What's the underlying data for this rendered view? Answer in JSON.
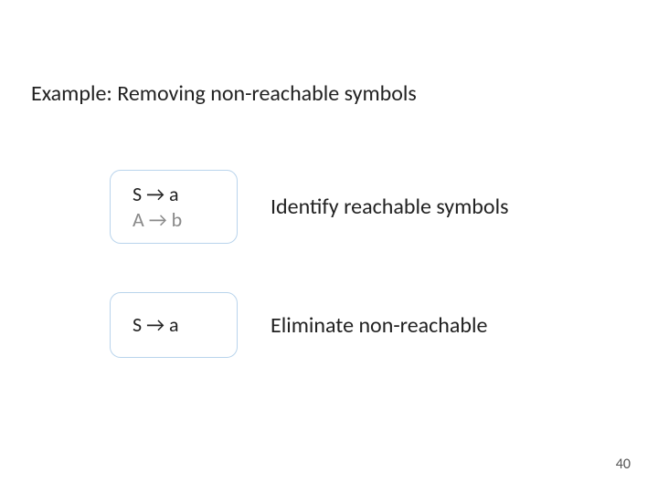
{
  "title": "Example: Removing non-reachable symbols",
  "steps": [
    {
      "grammar": [
        {
          "text": "S → a",
          "faded": false
        },
        {
          "text": "A → b",
          "faded": true
        }
      ],
      "label": "Identify reachable symbols"
    },
    {
      "grammar": [
        {
          "text": "S → a",
          "faded": false
        }
      ],
      "label": "Eliminate non-reachable"
    }
  ],
  "page_number": "40"
}
